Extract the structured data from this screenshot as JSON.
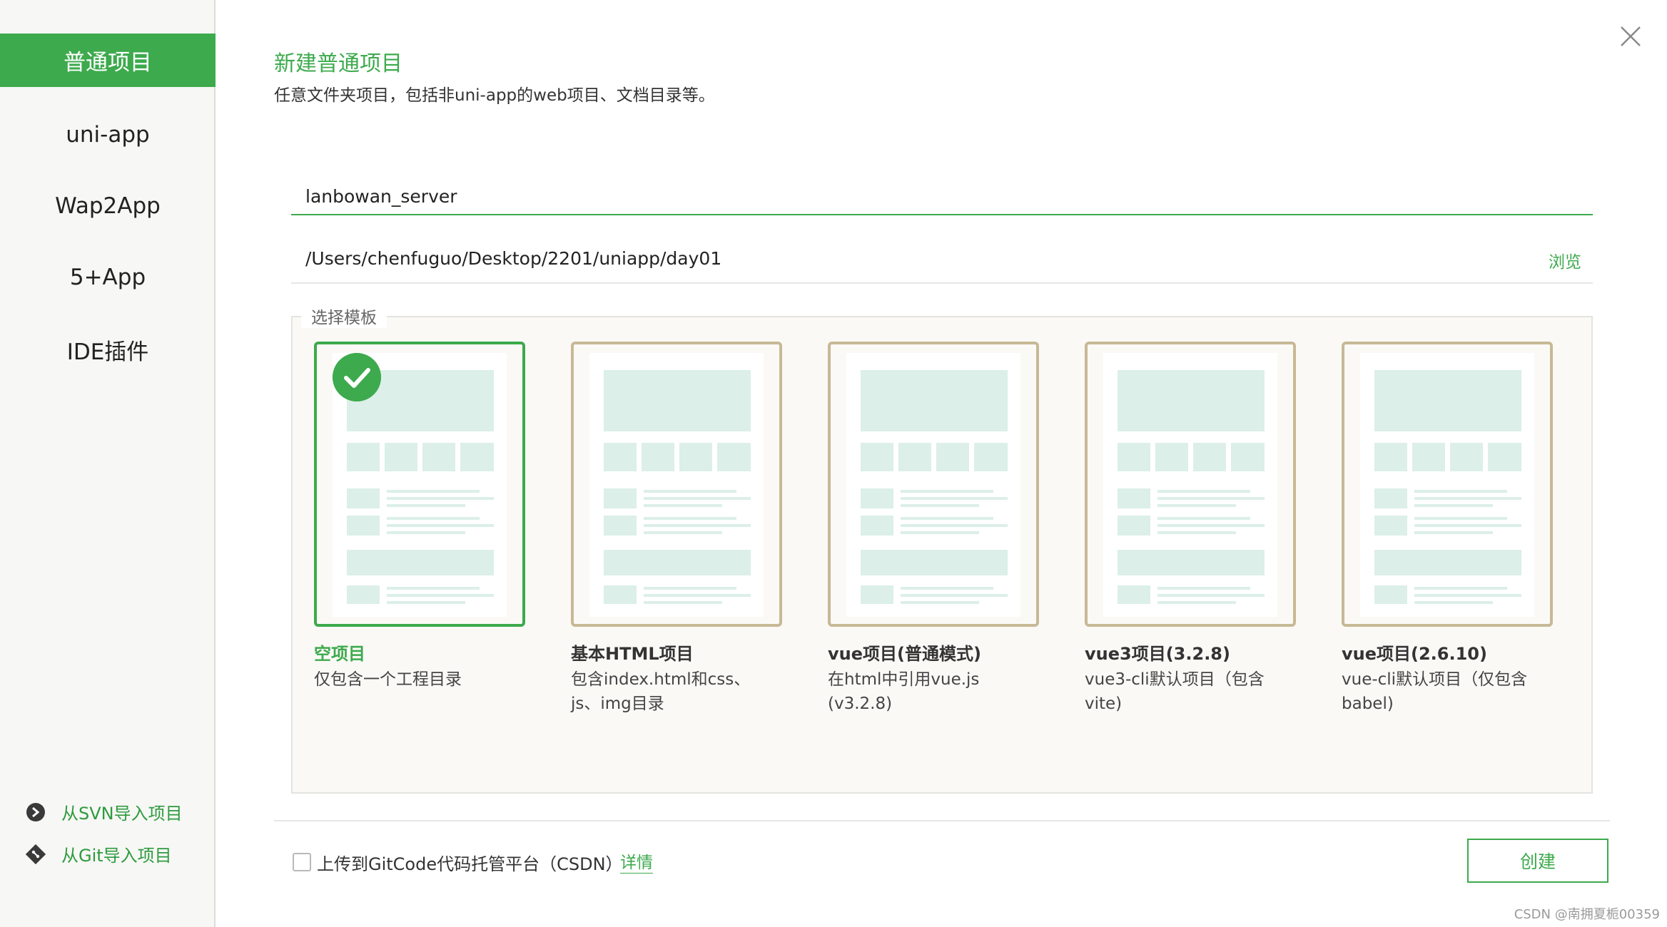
{
  "sidebar": {
    "items": [
      {
        "label": "普通项目",
        "active": true
      },
      {
        "label": "uni-app"
      },
      {
        "label": "Wap2App"
      },
      {
        "label": "5+App"
      },
      {
        "label": "IDE插件"
      }
    ],
    "import_svn": "从SVN导入项目",
    "import_git": "从Git导入项目"
  },
  "header": {
    "title": "新建普通项目",
    "subtitle": "任意文件夹项目，包括非uni-app的web项目、文档目录等。"
  },
  "form": {
    "project_name": "lanbowan_server",
    "path": "/Users/chenfuguo/Desktop/2201/uniapp/day01",
    "browse_label": "浏览"
  },
  "templates": {
    "legend": "选择模板",
    "items": [
      {
        "title": "空项目",
        "desc": "仅包含一个工程目录",
        "selected": true
      },
      {
        "title": "基本HTML项目",
        "desc": "包含index.html和css、\njs、img目录"
      },
      {
        "title": "vue项目(普通模式)",
        "desc": "在html中引用vue.js\n(v3.2.8)"
      },
      {
        "title": "vue3项目(3.2.8)",
        "desc": "vue3-cli默认项目（包含\nvite)"
      },
      {
        "title": "vue项目(2.6.10)",
        "desc": "vue-cli默认项目（仅包含\nbabel)"
      }
    ]
  },
  "footer": {
    "upload_label": "上传到GitCode代码托管平台（CSDN）",
    "detail_link": "详情",
    "create_button": "创建",
    "watermark": "CSDN @南拥夏栀00359"
  },
  "colors": {
    "accent": "#3daa4d",
    "card_border": "#c7b995",
    "thumb_fill": "#dcefe9"
  }
}
